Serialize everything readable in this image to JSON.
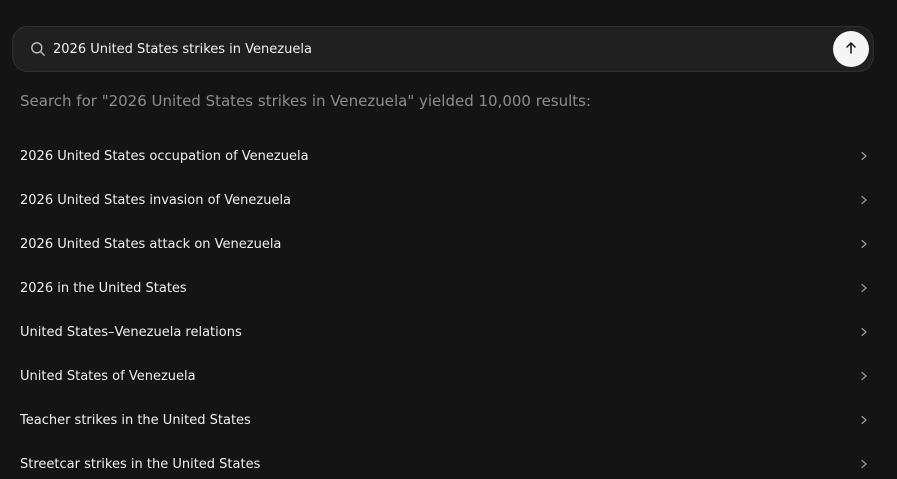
{
  "search": {
    "query": "2026 United States strikes in Venezuela",
    "search_icon": "search-icon",
    "submit_icon": "arrow-up-icon"
  },
  "summary_text": "Search for \"2026 United States strikes in Venezuela\" yielded 10,000 results:",
  "results": [
    {
      "label": "2026 United States occupation of Venezuela"
    },
    {
      "label": "2026 United States invasion of Venezuela"
    },
    {
      "label": "2026 United States attack on Venezuela"
    },
    {
      "label": "2026 in the United States"
    },
    {
      "label": "United States–Venezuela relations"
    },
    {
      "label": "United States of Venezuela"
    },
    {
      "label": "Teacher strikes in the United States"
    },
    {
      "label": "Streetcar strikes in the United States"
    }
  ],
  "colors": {
    "background": "#141414",
    "search_bar": "#202020",
    "summary_text": "#8d8d8d",
    "submit_button": "#f5f5f5"
  }
}
